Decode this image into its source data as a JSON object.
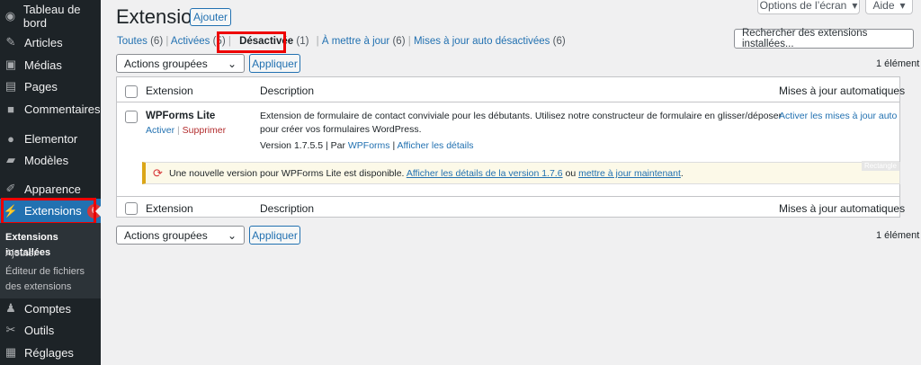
{
  "sidebar": {
    "items": [
      {
        "label": "Tableau de bord",
        "icon": "dashboard-icon"
      },
      {
        "label": "Articles",
        "icon": "pin-icon"
      },
      {
        "label": "Médias",
        "icon": "media-icon"
      },
      {
        "label": "Pages",
        "icon": "pages-icon"
      },
      {
        "label": "Commentaires",
        "icon": "comment-icon"
      },
      {
        "label": "Elementor",
        "icon": "elementor-icon"
      },
      {
        "label": "Modèles",
        "icon": "folder-icon"
      },
      {
        "label": "Apparence",
        "icon": "brush-icon"
      },
      {
        "label": "Extensions",
        "icon": "plugin-icon",
        "badge": "6"
      },
      {
        "label": "Comptes",
        "icon": "user-icon"
      },
      {
        "label": "Outils",
        "icon": "wrench-icon"
      },
      {
        "label": "Réglages",
        "icon": "settings-icon"
      }
    ],
    "submenu": [
      "Extensions installées",
      "Ajouter",
      "Éditeur de fichiers des extensions"
    ]
  },
  "header": {
    "title": "Extensions",
    "add_label": "Ajouter",
    "screen_options": "Options de l’écran",
    "help": "Aide"
  },
  "filters": [
    {
      "label": "Toutes",
      "count": "(6)"
    },
    {
      "label": "Activées",
      "count": "(5)"
    },
    {
      "label": "Désactivée",
      "count": "(1)"
    },
    {
      "label": "À mettre à jour",
      "count": "(6)"
    },
    {
      "label": "Mises à jour auto désactivées",
      "count": "(6)"
    }
  ],
  "search": {
    "placeholder": "Rechercher des extensions installées..."
  },
  "bulk": {
    "selected": "Actions groupées",
    "apply": "Appliquer",
    "count": "1 élément"
  },
  "table": {
    "col_extension": "Extension",
    "col_description": "Description",
    "col_auto": "Mises à jour automatiques",
    "row": {
      "name": "WPForms Lite",
      "activate": "Activer",
      "delete": "Supprimer",
      "desc1": "Extension de formulaire de contact conviviale pour les débutants. Utilisez notre constructeur de formulaire en glisser/déposer",
      "desc2": "pour créer vos formulaires WordPress.",
      "version": "Version 1.7.5.5 | Par",
      "author": "WPForms",
      "details": "Afficher les détails",
      "auto": "Activer les mises à jour auto"
    },
    "notice": {
      "text": "Une nouvelle version pour WPForms Lite est disponible.",
      "link1": "Afficher les détails de la version 1.7.6",
      "or": "ou",
      "link2": "mettre à jour maintenant",
      "end": ".",
      "tag": "Rectangle"
    }
  }
}
